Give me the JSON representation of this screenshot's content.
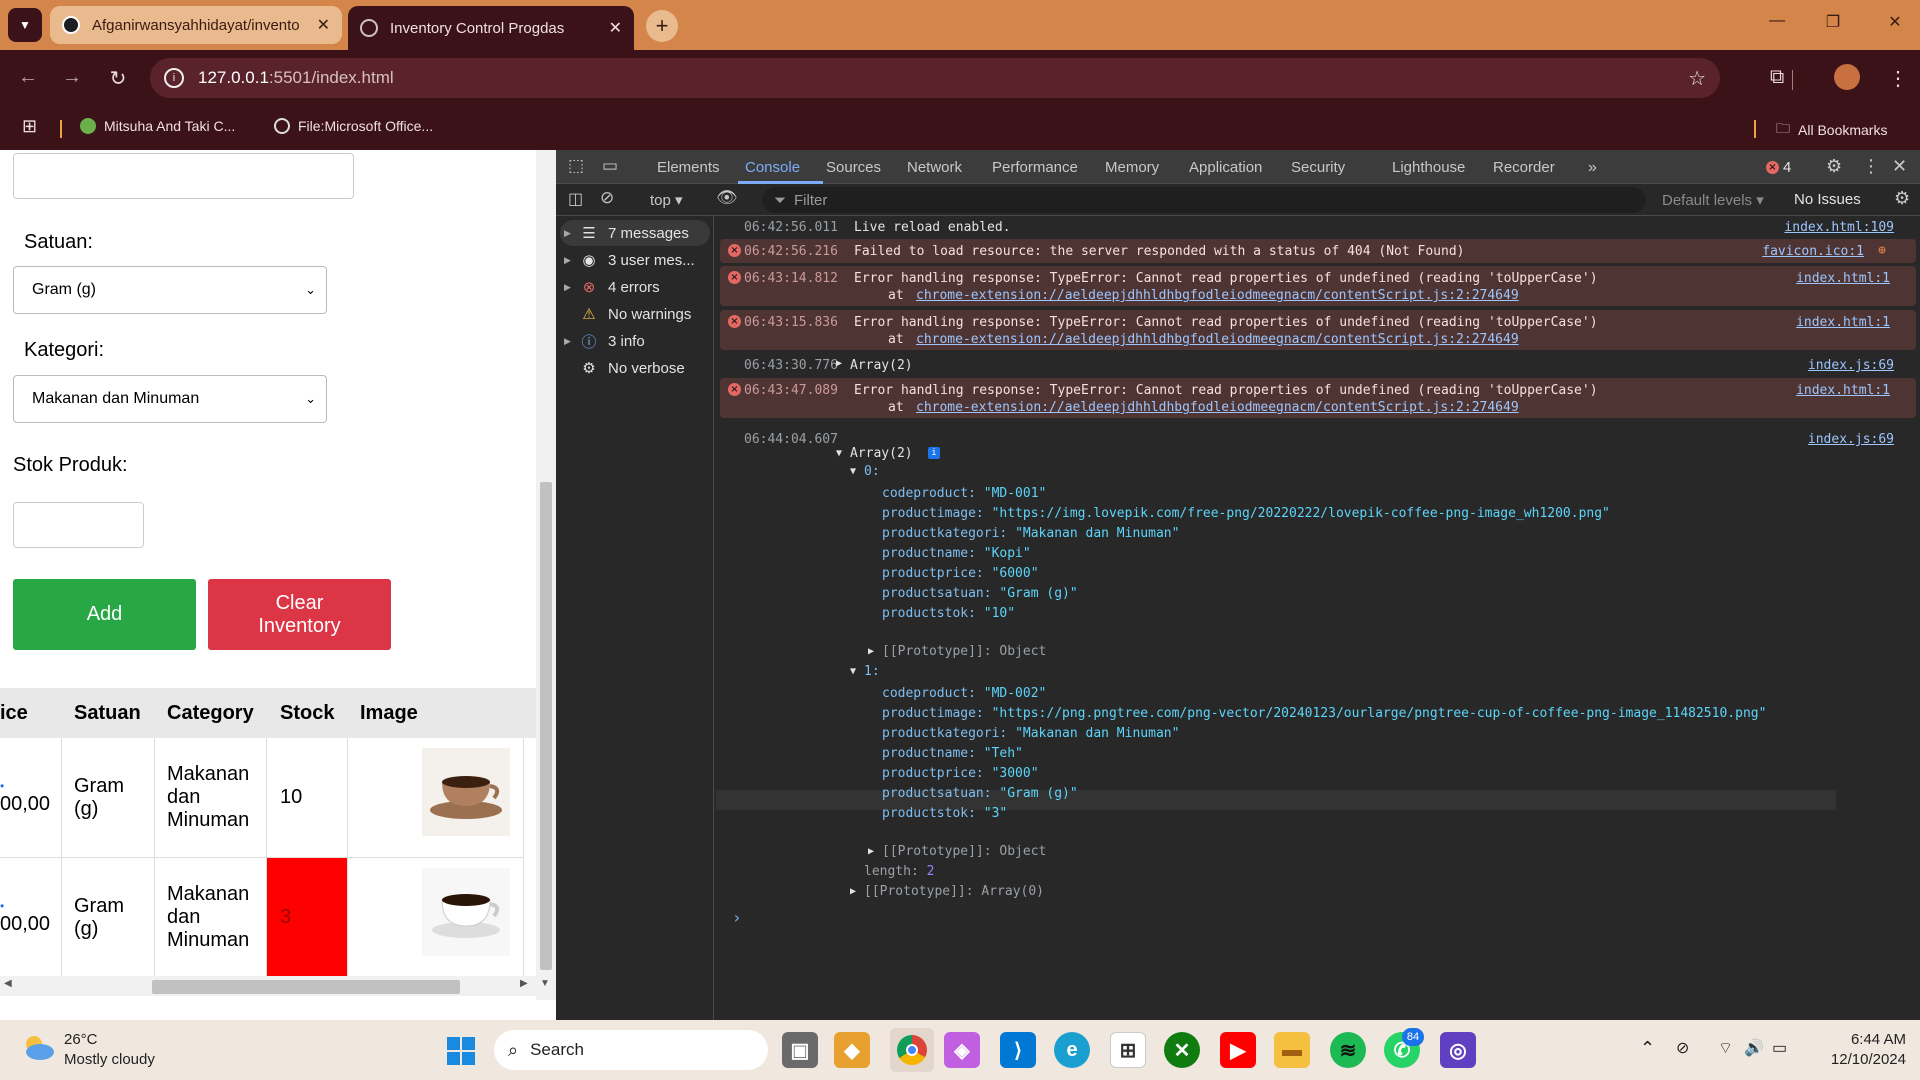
{
  "browser": {
    "tabs": [
      {
        "title": "Afganirwansyahhidayat/invento"
      },
      {
        "title": "Inventory Control Progdas"
      }
    ],
    "url_host": "127.0.0.1",
    "url_path": ":5501/index.html",
    "bookmarks": [
      "Mitsuha And Taki C...",
      "File:Microsoft Office..."
    ],
    "all_bookmarks": "All Bookmarks"
  },
  "page": {
    "satuan_label": "Satuan:",
    "satuan_value": "Gram (g)",
    "kategori_label": "Kategori:",
    "kategori_value": "Makanan dan Minuman",
    "stok_label": "Stok Produk:",
    "add_label": "Add",
    "clear_label_1": "Clear",
    "clear_label_2": "Inventory",
    "table": {
      "headers": [
        "ice",
        "Satuan",
        "Category",
        "Stock",
        "Image"
      ],
      "rows": [
        {
          "price_top": "",
          "price_bottom": "00,00",
          "satuan": [
            "Gram",
            "(g)"
          ],
          "category": [
            "Makanan",
            "dan",
            "Minuman"
          ],
          "stock": "10",
          "low": false
        },
        {
          "price_top": "",
          "price_bottom": "00,00",
          "satuan": [
            "Gram",
            "(g)"
          ],
          "category": [
            "Makanan",
            "dan",
            "Minuman"
          ],
          "stock": "3",
          "low": true
        }
      ]
    }
  },
  "devtools": {
    "tabs": [
      "Elements",
      "Console",
      "Sources",
      "Network",
      "Performance",
      "Memory",
      "Application",
      "Security",
      "Lighthouse",
      "Recorder"
    ],
    "active_tab": "Console",
    "error_count": "4",
    "context": "top",
    "filter_placeholder": "Filter",
    "levels": "Default levels",
    "issues": "No Issues",
    "sidebar": [
      {
        "label": "7 messages",
        "icon": "list-icon"
      },
      {
        "label": "3 user mes...",
        "icon": "user-icon"
      },
      {
        "label": "4 errors",
        "icon": "error-icon"
      },
      {
        "label": "No warnings",
        "icon": "warning-icon"
      },
      {
        "label": "3 info",
        "icon": "info-icon"
      },
      {
        "label": "No verbose",
        "icon": "gear-icon"
      }
    ],
    "logs": [
      {
        "ts": "06:42:56.011",
        "msg": "Live reload enabled.",
        "src": "index.html:109"
      },
      {
        "ts": "06:42:56.216",
        "msg": "Failed to load resource: the server responded with a status of 404 (Not Found)",
        "src": "favicon.ico:1"
      },
      {
        "ts": "06:43:14.812",
        "msg": "Error handling response: TypeError: Cannot read properties of undefined (reading 'toUpperCase')",
        "at": "chrome-extension://aeldeepjdhhldhbgfodleiodmeegnacm/contentScript.js:2:274649",
        "src": "index.html:1"
      },
      {
        "ts": "06:43:15.836",
        "msg": "Error handling response: TypeError: Cannot read properties of undefined (reading 'toUpperCase')",
        "at": "chrome-extension://aeldeepjdhhldhbgfodleiodmeegnacm/contentScript.js:2:274649",
        "src": "index.html:1"
      },
      {
        "ts": "06:43:30.776",
        "msg": "Array(2)",
        "src": "index.js:69"
      },
      {
        "ts": "06:43:47.089",
        "msg": "Error handling response: TypeError: Cannot read properties of undefined (reading 'toUpperCase')",
        "at": "chrome-extension://aeldeepjdhhldhbgfodleiodmeegnacm/contentScript.js:2:274649",
        "src": "index.html:1"
      },
      {
        "ts": "06:44:04.607",
        "msg": "Array(2)",
        "src": "index.js:69"
      }
    ],
    "at_prefix": "at",
    "objects": [
      {
        "index": "0:",
        "codeproduct": "\"MD-001\"",
        "productimage": "\"https://img.lovepik.com/free-png/20220222/lovepik-coffee-png-image_wh1200.png\"",
        "productkategori": "\"Makanan dan Minuman\"",
        "productname": "\"Kopi\"",
        "productprice": "\"6000\"",
        "productsatuan": "\"Gram (g)\"",
        "productstok": "\"10\""
      },
      {
        "index": "1:",
        "codeproduct": "\"MD-002\"",
        "productimage": "\"https://png.pngtree.com/png-vector/20240123/ourlarge/pngtree-cup-of-coffee-png-image_11482510.png\"",
        "productkategori": "\"Makanan dan Minuman\"",
        "productname": "\"Teh\"",
        "productprice": "\"3000\"",
        "productsatuan": "\"Gram (g)\"",
        "productstok": "\"3\""
      }
    ],
    "keys": [
      "codeproduct:",
      "productimage:",
      "productkategori:",
      "productname:",
      "productprice:",
      "productsatuan:",
      "productstok:"
    ],
    "prototype_obj": "[[Prototype]]: Object",
    "length_key": "length:",
    "length_val": "2",
    "prototype_arr": "[[Prototype]]: Array(0)"
  },
  "taskbar": {
    "temp": "26°C",
    "weather": "Mostly cloudy",
    "search": "Search",
    "badge": "84",
    "time": "6:44 AM",
    "date": "12/10/2024"
  }
}
